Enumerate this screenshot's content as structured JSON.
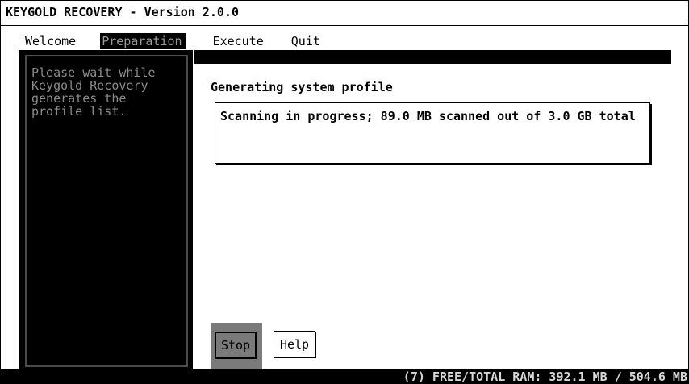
{
  "app": {
    "title": "KEYGOLD RECOVERY - Version 2.0.0"
  },
  "menu": {
    "items": [
      {
        "label": "Welcome"
      },
      {
        "label": "Preparation"
      },
      {
        "label": "Execute"
      },
      {
        "label": "Quit"
      }
    ],
    "active": "Preparation"
  },
  "sidebar": {
    "text": "Please wait while\nKeygold Recovery\ngenerates the\nprofile list."
  },
  "main": {
    "heading": "Generating system profile",
    "progress_message": "Scanning in progress; 89.0 MB scanned out of 3.0 GB total"
  },
  "buttons": {
    "stop_label": "Stop",
    "help_label": "Help"
  },
  "status": {
    "text": "(7)  FREE/TOTAL RAM: 392.1 MB / 504.6 MB"
  },
  "colors": {
    "background": "#ffffff",
    "foreground": "#000000",
    "dim_text": "#8c8c8c",
    "selected_button": "#7a7a7a"
  }
}
